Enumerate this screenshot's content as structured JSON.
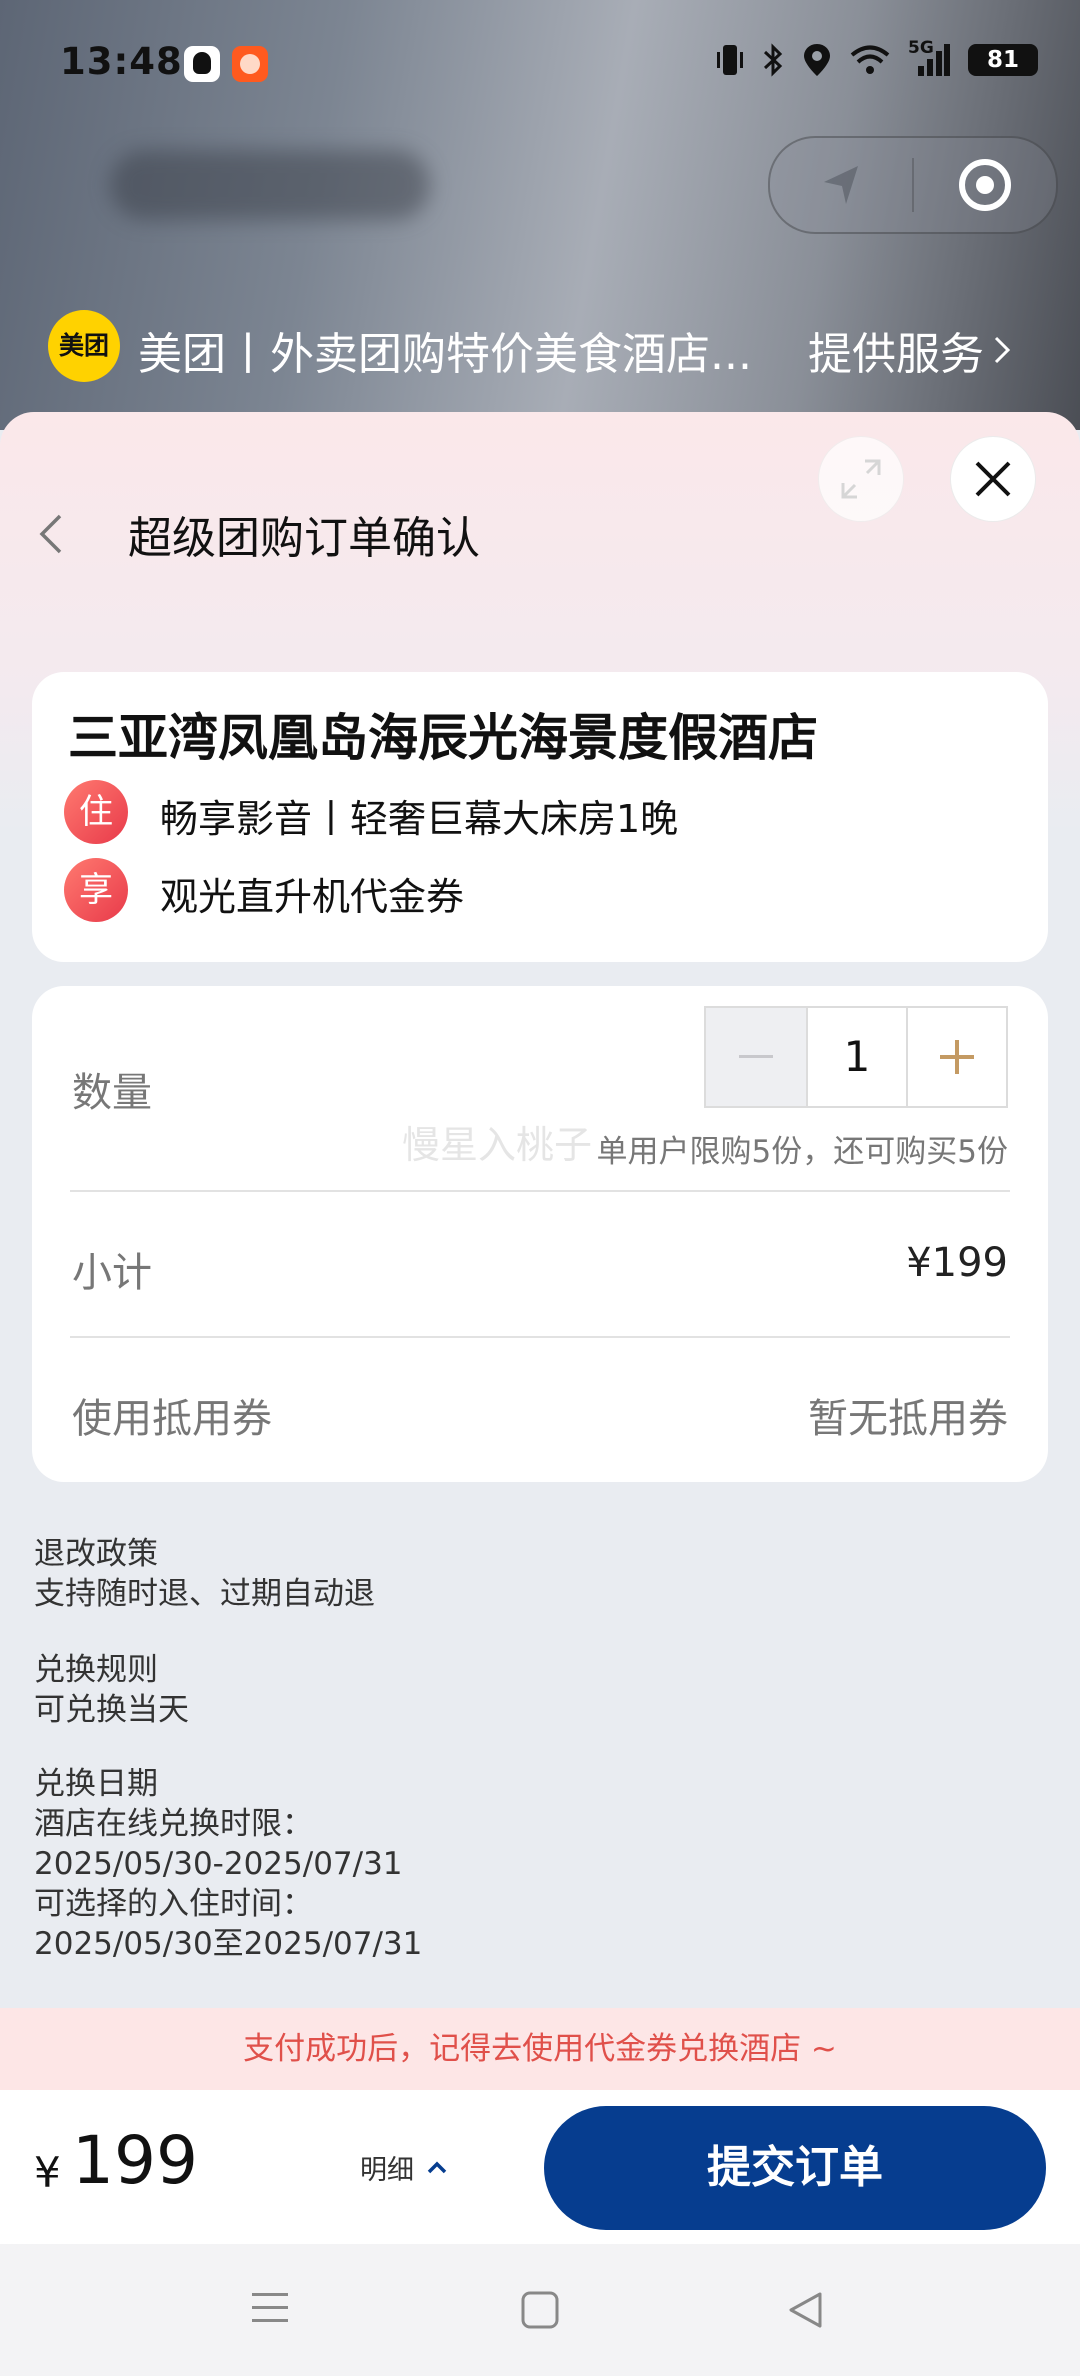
{
  "status_bar": {
    "time": "13:48",
    "battery": "81",
    "network": "5G",
    "icons": [
      "qq-icon",
      "taobao-icon",
      "vibrate-icon",
      "bluetooth-icon",
      "location-icon",
      "wifi-icon",
      "signal-icon",
      "battery-icon"
    ]
  },
  "mini_program": {
    "logo_text": "美团",
    "name": "美团丨外卖团购特价美食酒店...",
    "service_link": "提供服务"
  },
  "header": {
    "title": "超级团购订单确认"
  },
  "hotel": {
    "name": "三亚湾凤凰岛海辰光海景度假酒店",
    "items": [
      {
        "tag": "住",
        "text": "畅享影音丨轻奢巨幕大床房1晚"
      },
      {
        "tag": "享",
        "text": "观光直升机代金券"
      }
    ]
  },
  "order": {
    "quantity_label": "数量",
    "quantity_value": "1",
    "limit_note": "单用户限购5份，还可购买5份",
    "watermark": "慢星入桃子",
    "subtotal_label": "小计",
    "subtotal_value": "¥199",
    "coupon_label": "使用抵用券",
    "coupon_value": "暂无抵用券"
  },
  "policies": {
    "refund_title": "退改政策",
    "refund_text": "支持随时退、过期自动退",
    "exchange_title": "兑换规则",
    "exchange_text": "可兑换当天",
    "date_title": "兑换日期",
    "online_label": "酒店在线兑换时限：",
    "online_range": "2025/05/30-2025/07/31",
    "checkin_label": "可选择的入住时间：",
    "checkin_range": "2025/05/30至2025/07/31"
  },
  "notice": "支付成功后，记得去使用代金券兑换酒店 ~",
  "footer": {
    "currency": "¥",
    "total": "199",
    "detail_label": "明细",
    "submit_label": "提交订单"
  },
  "colors": {
    "brand_blue": "#063d8f",
    "meituan_yellow": "#ffd200",
    "tag_red": "#e83a4a",
    "notice_red": "#e0504a",
    "stepper_plus": "#c49a63"
  }
}
